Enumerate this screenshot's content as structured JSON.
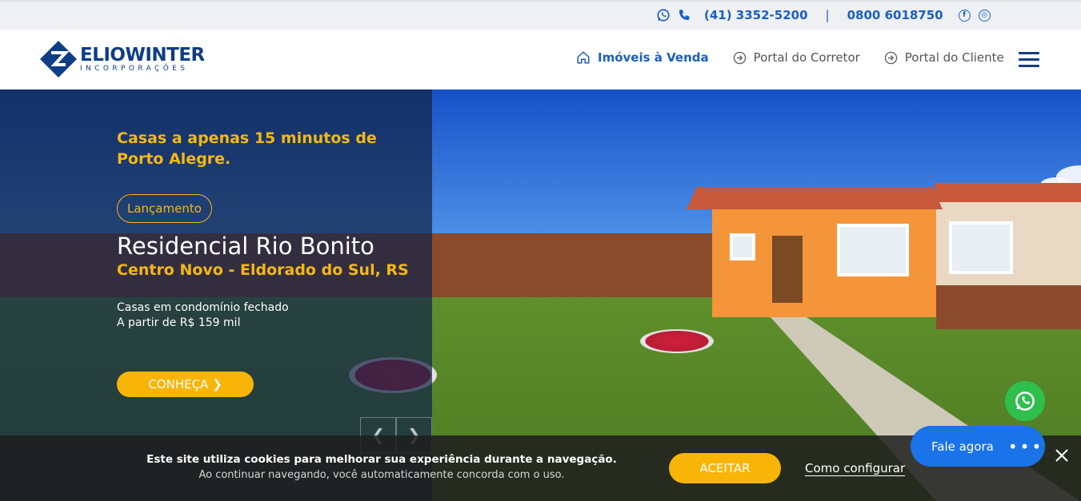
{
  "topbar": {
    "phone": "(41) 3352-5200",
    "separator": "|",
    "toll_free": "0800 6018750",
    "facebook": "f",
    "instagram": "◎"
  },
  "brand": {
    "name": "ELIOWINTER",
    "sub": "INCORPORAÇÕES",
    "color": "#0f3d86"
  },
  "nav": {
    "items": [
      {
        "label": "Imóveis à Venda",
        "icon": "home-icon"
      },
      {
        "label": "Portal do Corretor",
        "icon": "login-arrow-icon"
      },
      {
        "label": "Portal do Cliente",
        "icon": "login-arrow-icon"
      }
    ]
  },
  "hero": {
    "tagline": "Casas a apenas 15 minutos de Porto Alegre.",
    "badge": "Lançamento",
    "title": "Residencial Rio Bonito",
    "location": "Centro Novo - Eldorado do Sul, RS",
    "desc_line1": "Casas em condomínio fechado",
    "desc_line2": "A partir de R$ 159 mil",
    "cta": "CONHEÇA ❯",
    "prev": "❮",
    "next": "❯",
    "accent": "#f5b814"
  },
  "cookie": {
    "main": "Este site utiliza cookies para melhorar sua experiência durante a navegação.",
    "sub": "Ao continuar navegando, você automaticamente concorda com o uso.",
    "accept": "ACEITAR",
    "configure": "Como configurar"
  },
  "chat": {
    "label": "Fale agora",
    "dots": "•••"
  }
}
